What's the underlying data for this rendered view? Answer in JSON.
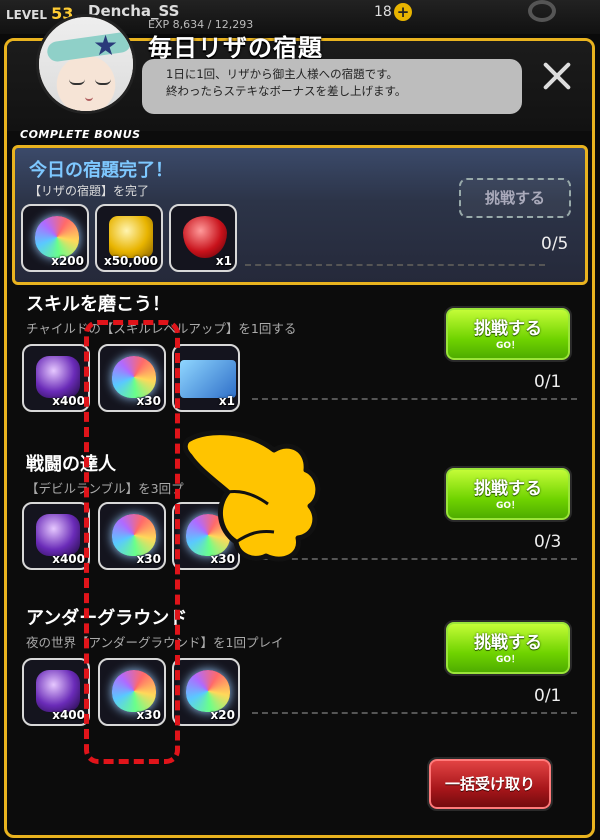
{
  "topbar": {
    "level_label": "LEVEL",
    "level_value": "53",
    "player_name": "Dencha_SS",
    "exp_text": "EXP 8,634 / 12,293",
    "coins": "18"
  },
  "dialog": {
    "title": "毎日リザの宿題",
    "speech_line1": "1日に1回、リザから御主人様への宿題です。",
    "speech_line2": "終わったらステキなボーナスを差し上げます。"
  },
  "complete_bonus": {
    "label": "COMPLETE BONUS",
    "title": "今日の宿題完了！",
    "subtitle": "【リザの宿題】を完了",
    "button_label": "挑戦する",
    "progress": "0/5",
    "rewards": [
      {
        "icon": "rainbow-gem-icon",
        "qty": "x200"
      },
      {
        "icon": "gold-coin-icon",
        "qty": "x50,000"
      },
      {
        "icon": "red-crystal-icon",
        "qty": "x1"
      }
    ]
  },
  "missions": [
    {
      "title": "スキルを磨こう！",
      "desc": "チャイルドの【スキルレベルアップ】を1回する",
      "button_label": "挑戦する",
      "button_sub": "GO！",
      "progress": "0/1",
      "rewards": [
        {
          "icon": "purple-crystal-icon",
          "qty": "x400"
        },
        {
          "icon": "rainbow-gem-icon",
          "qty": "x30"
        },
        {
          "icon": "blue-card-icon",
          "qty": "x1"
        }
      ]
    },
    {
      "title": "戦闘の達人",
      "desc": "【デビルランブル】を3回プ",
      "button_label": "挑戦する",
      "button_sub": "GO！",
      "progress": "0/3",
      "rewards": [
        {
          "icon": "purple-crystal-icon",
          "qty": "x400"
        },
        {
          "icon": "rainbow-gem-icon",
          "qty": "x30"
        },
        {
          "icon": "rainbow-gem-icon",
          "qty": "x30"
        }
      ]
    },
    {
      "title": "アンダーグラウンド",
      "desc": "夜の世界【アンダーグラウンド】を1回プレイ",
      "button_label": "挑戦する",
      "button_sub": "GO！",
      "progress": "0/1",
      "rewards": [
        {
          "icon": "purple-crystal-icon",
          "qty": "x400"
        },
        {
          "icon": "rainbow-gem-icon",
          "qty": "x30"
        },
        {
          "icon": "rainbow-gem-icon",
          "qty": "x20"
        }
      ]
    }
  ],
  "bulk_button_label": "一括受け取り",
  "colors": {
    "panel_border": "#e9b31f",
    "go_button": "#6fd300",
    "bulk_button": "#a7161a",
    "highlight": "#e0141a"
  }
}
